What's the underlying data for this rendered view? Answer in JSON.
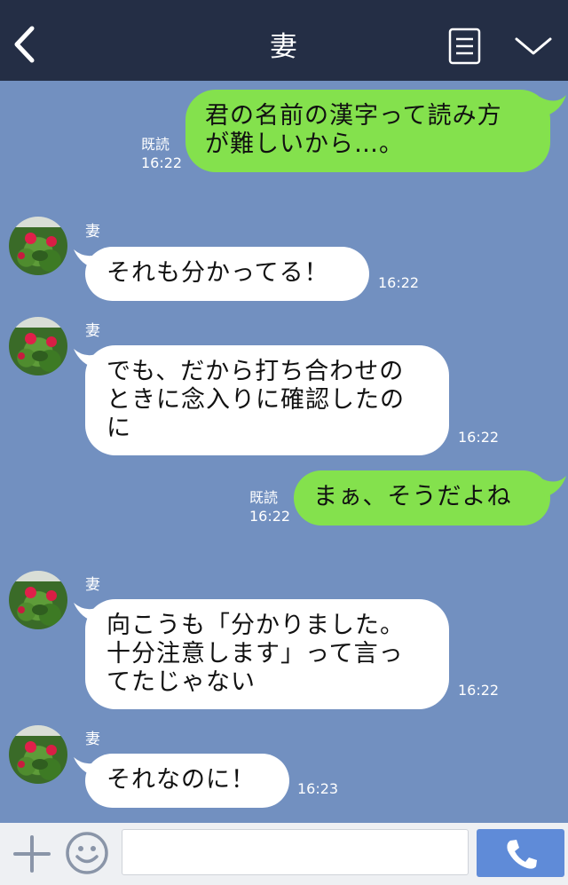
{
  "header": {
    "title": "妻"
  },
  "messages": [
    {
      "text": "君の名前の漢字って読み方\nが難しいから…。",
      "read": "既読",
      "time": "16:22"
    },
    {
      "sender": "妻",
      "text": "それも分かってる！",
      "time": "16:22"
    },
    {
      "sender": "妻",
      "text": "でも、だから打ち合わせの\nときに念入りに確認したの\nに",
      "time": "16:22"
    },
    {
      "text": "まぁ、そうだよね",
      "read": "既読",
      "time": "16:22"
    },
    {
      "sender": "妻",
      "text": "向こうも「分かりました。\n十分注意します」って言っ\nてたじゃない",
      "time": "16:22"
    },
    {
      "sender": "妻",
      "text": "それなのに！",
      "time": "16:23"
    }
  ],
  "input": {
    "value": "",
    "placeholder": ""
  },
  "icons": {
    "back": "chevron-left-icon",
    "memo": "note-icon",
    "menu": "chevron-down-icon",
    "plus": "plus-icon",
    "emoji": "smiley-icon",
    "call": "phone-icon"
  },
  "colors": {
    "header": "#242e45",
    "background": "#7290c0",
    "outgoing_bubble": "#84e14d",
    "incoming_bubble": "#ffffff",
    "call_button": "#5f8bd8"
  }
}
